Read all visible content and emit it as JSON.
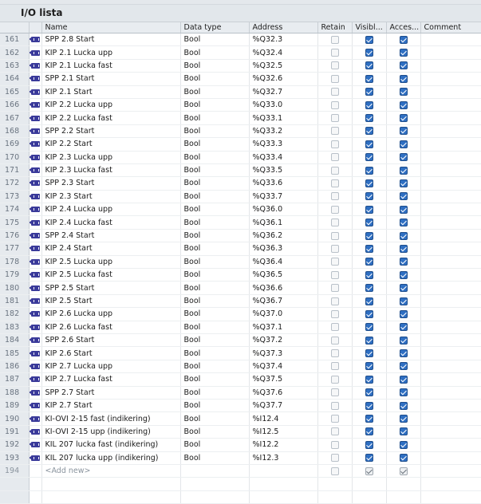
{
  "title": "I/O lista",
  "columns": {
    "name": "Name",
    "data_type": "Data type",
    "address": "Address",
    "retain": "Retain",
    "visible": "Visibl...",
    "accessible": "Acces...",
    "comment": "Comment"
  },
  "icon": "tag-variable-icon",
  "rows": [
    {
      "num": "161",
      "name": "SPP 2.8 Start",
      "type": "Bool",
      "address": "%Q32.3"
    },
    {
      "num": "162",
      "name": "KIP 2.1 Lucka upp",
      "type": "Bool",
      "address": "%Q32.4"
    },
    {
      "num": "163",
      "name": "KIP 2.1 Lucka fast",
      "type": "Bool",
      "address": "%Q32.5"
    },
    {
      "num": "164",
      "name": "SPP 2.1 Start",
      "type": "Bool",
      "address": "%Q32.6"
    },
    {
      "num": "165",
      "name": "KIP 2.1 Start",
      "type": "Bool",
      "address": "%Q32.7"
    },
    {
      "num": "166",
      "name": "KIP 2.2 Lucka upp",
      "type": "Bool",
      "address": "%Q33.0"
    },
    {
      "num": "167",
      "name": "KIP 2.2 Lucka fast",
      "type": "Bool",
      "address": "%Q33.1"
    },
    {
      "num": "168",
      "name": "SPP 2.2 Start",
      "type": "Bool",
      "address": "%Q33.2"
    },
    {
      "num": "169",
      "name": "KIP 2.2 Start",
      "type": "Bool",
      "address": "%Q33.3"
    },
    {
      "num": "170",
      "name": "KIP 2.3 Lucka upp",
      "type": "Bool",
      "address": "%Q33.4"
    },
    {
      "num": "171",
      "name": "KIP 2.3 Lucka fast",
      "type": "Bool",
      "address": "%Q33.5"
    },
    {
      "num": "172",
      "name": "SPP 2.3 Start",
      "type": "Bool",
      "address": "%Q33.6"
    },
    {
      "num": "173",
      "name": "KIP 2.3 Start",
      "type": "Bool",
      "address": "%Q33.7"
    },
    {
      "num": "174",
      "name": "KIP 2.4 Lucka upp",
      "type": "Bool",
      "address": "%Q36.0"
    },
    {
      "num": "175",
      "name": "KIP 2.4 Lucka fast",
      "type": "Bool",
      "address": "%Q36.1"
    },
    {
      "num": "176",
      "name": "SPP 2.4 Start",
      "type": "Bool",
      "address": "%Q36.2"
    },
    {
      "num": "177",
      "name": "KIP 2.4 Start",
      "type": "Bool",
      "address": "%Q36.3"
    },
    {
      "num": "178",
      "name": "KIP 2.5 Lucka upp",
      "type": "Bool",
      "address": "%Q36.4"
    },
    {
      "num": "179",
      "name": "KIP 2.5 Lucka fast",
      "type": "Bool",
      "address": "%Q36.5"
    },
    {
      "num": "180",
      "name": "SPP 2.5 Start",
      "type": "Bool",
      "address": "%Q36.6"
    },
    {
      "num": "181",
      "name": "KIP 2.5 Start",
      "type": "Bool",
      "address": "%Q36.7"
    },
    {
      "num": "182",
      "name": "KIP 2.6 Lucka upp",
      "type": "Bool",
      "address": "%Q37.0"
    },
    {
      "num": "183",
      "name": "KIP 2.6 Lucka fast",
      "type": "Bool",
      "address": "%Q37.1"
    },
    {
      "num": "184",
      "name": "SPP 2.6 Start",
      "type": "Bool",
      "address": "%Q37.2"
    },
    {
      "num": "185",
      "name": "KIP 2.6 Start",
      "type": "Bool",
      "address": "%Q37.3"
    },
    {
      "num": "186",
      "name": "KIP 2.7 Lucka upp",
      "type": "Bool",
      "address": "%Q37.4"
    },
    {
      "num": "187",
      "name": "KIP 2.7 Lucka fast",
      "type": "Bool",
      "address": "%Q37.5"
    },
    {
      "num": "188",
      "name": "SPP 2.7 Start",
      "type": "Bool",
      "address": "%Q37.6"
    },
    {
      "num": "189",
      "name": "KIP 2.7 Start",
      "type": "Bool",
      "address": "%Q37.7"
    },
    {
      "num": "190",
      "name": "KI-OVI 2-15 fast (indikering)",
      "type": "Bool",
      "address": "%I12.4"
    },
    {
      "num": "191",
      "name": "KI-OVI 2-15 upp (indikering)",
      "type": "Bool",
      "address": "%I12.5"
    },
    {
      "num": "192",
      "name": "KIL 207 lucka fast (indikering)",
      "type": "Bool",
      "address": "%I12.2"
    },
    {
      "num": "193",
      "name": "KIL 207 lucka upp (indikering)",
      "type": "Bool",
      "address": "%I12.3"
    }
  ],
  "new_row": {
    "num": "194",
    "label": "<Add new>"
  }
}
